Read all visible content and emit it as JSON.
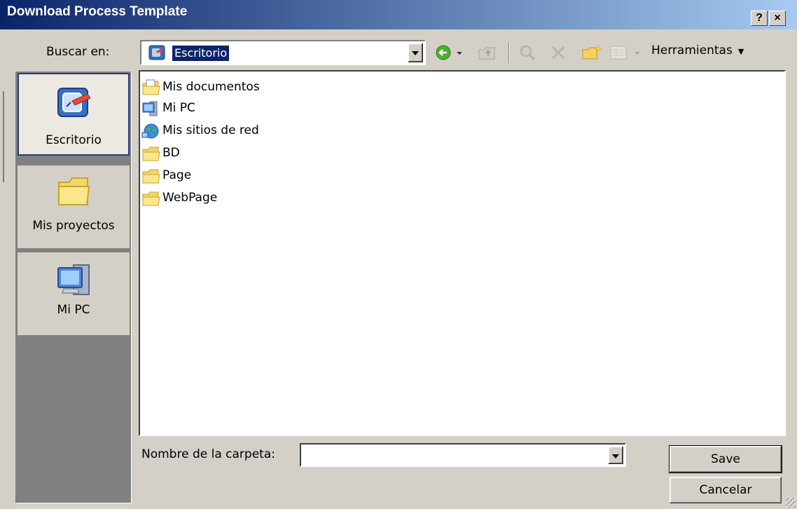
{
  "window": {
    "title": "Download Process Template",
    "help_label": "?",
    "close_label": "×"
  },
  "look_in": {
    "label": "Buscar en:",
    "value": "Escritorio",
    "icon": "desktop-icon"
  },
  "toolbar": {
    "tools_label": "Herramientas",
    "back_icon": "back-arrow-icon",
    "up_icon": "up-folder-icon",
    "search_icon": "search-web-icon",
    "delete_icon": "delete-icon",
    "new_folder_icon": "new-folder-icon",
    "views_icon": "views-icon"
  },
  "places": [
    {
      "label": "Escritorio",
      "icon": "desktop-icon",
      "selected": true
    },
    {
      "label": "Mis proyectos",
      "icon": "folder-icon",
      "selected": false
    },
    {
      "label": "Mi PC",
      "icon": "computer-icon",
      "selected": false
    }
  ],
  "files": [
    {
      "label": "Mis documentos",
      "icon": "documents-folder-icon"
    },
    {
      "label": "Mi PC",
      "icon": "computer-icon"
    },
    {
      "label": "Mis sitios de red",
      "icon": "network-icon"
    },
    {
      "label": "BD",
      "icon": "folder-icon"
    },
    {
      "label": "Page",
      "icon": "folder-icon"
    },
    {
      "label": "WebPage",
      "icon": "folder-icon"
    }
  ],
  "folder_name": {
    "label": "Nombre de la carpeta:",
    "value": ""
  },
  "buttons": {
    "save": "Save",
    "cancel": "Cancelar"
  },
  "colors": {
    "title_start": "#0a246a",
    "title_end": "#a6caf0",
    "face": "#d4d0c8",
    "selection": "#0a246a"
  }
}
